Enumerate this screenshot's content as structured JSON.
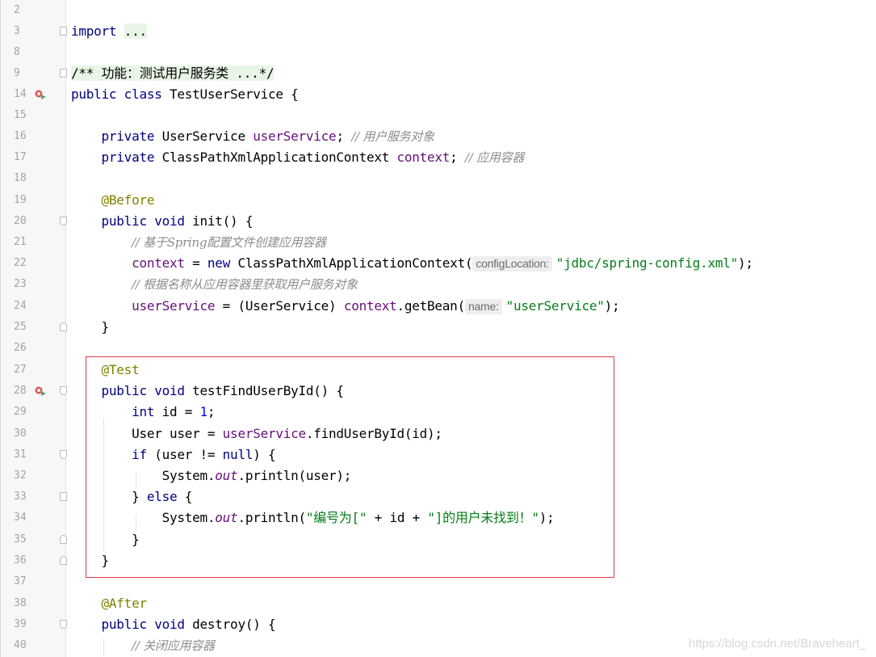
{
  "lines": [
    {
      "n": "2"
    },
    {
      "n": "3"
    },
    {
      "n": "8"
    },
    {
      "n": "9"
    },
    {
      "n": "14"
    },
    {
      "n": "15"
    },
    {
      "n": "16"
    },
    {
      "n": "17"
    },
    {
      "n": "18"
    },
    {
      "n": "19"
    },
    {
      "n": "20"
    },
    {
      "n": "21"
    },
    {
      "n": "22"
    },
    {
      "n": "23"
    },
    {
      "n": "24"
    },
    {
      "n": "25"
    },
    {
      "n": "26"
    },
    {
      "n": "27"
    },
    {
      "n": "28"
    },
    {
      "n": "29"
    },
    {
      "n": "30"
    },
    {
      "n": "31"
    },
    {
      "n": "32"
    },
    {
      "n": "33"
    },
    {
      "n": "34"
    },
    {
      "n": "35"
    },
    {
      "n": "36"
    },
    {
      "n": "37"
    },
    {
      "n": "38"
    },
    {
      "n": "39"
    },
    {
      "n": "40"
    }
  ],
  "code": {
    "import_kw": "import",
    "import_fold": "...",
    "doc_comment": "/** 功能：测试用户服务类 ...*/",
    "class_public": "public class",
    "class_name": "TestUserService {",
    "l16_private": "private",
    "l16_type": "UserService",
    "l16_field": "userService",
    "l16_semi": ";",
    "l16_comment": "// 用户服务对象",
    "l17_private": "private",
    "l17_type": "ClassPathXmlApplicationContext",
    "l17_field": "context",
    "l17_semi": ";",
    "l17_comment": "// 应用容器",
    "l19_ann": "@Before",
    "l20_kw": "public void",
    "l20_rest": "init() {",
    "l21_comment": "// 基于Spring配置文件创建应用容器",
    "l22_field": "context",
    "l22_eq": "=",
    "l22_new": "new",
    "l22_call": "ClassPathXmlApplicationContext(",
    "l22_hint": "configLocation:",
    "l22_str": "\"jdbc/spring-config.xml\"",
    "l22_end": ");",
    "l23_comment": "// 根据名称从应用容器里获取用户服务对象",
    "l24_field": "userService",
    "l24_mid": "= (UserService)",
    "l24_field2": "context",
    "l24_call": ".getBean(",
    "l24_hint": "name:",
    "l24_str": "\"userService\"",
    "l24_end": ");",
    "l25_close": "}",
    "l27_ann": "@Test",
    "l28_kw": "public void",
    "l28_rest": "testFindUserById() {",
    "l29_kw": "int",
    "l29_mid": "id =",
    "l29_num": "1",
    "l29_end": ";",
    "l30_a": "User user =",
    "l30_field": "userService",
    "l30_b": ".findUserById(id);",
    "l31_kw": "if",
    "l31_a": "(user !=",
    "l31_null": "null",
    "l31_b": ") {",
    "l32_a": "System.",
    "l32_out": "out",
    "l32_b": ".println(user);",
    "l33_a": "}",
    "l33_else": "else",
    "l33_b": "{",
    "l34_a": "System.",
    "l34_out": "out",
    "l34_b": ".println(",
    "l34_s1": "\"编号为[\"",
    "l34_c": "+ id +",
    "l34_s2": "\"]的用户未找到！\"",
    "l34_end": ");",
    "l35_close": "}",
    "l36_close": "}",
    "l38_ann": "@After",
    "l39_kw": "public void",
    "l39_rest": "destroy() {",
    "l40_comment": "// 关闭应用容器"
  },
  "watermark": "https://blog.csdn.net/Braveheart_",
  "colors": {
    "keyword": "#000080",
    "field": "#660e7a",
    "annotation": "#808000",
    "string": "#067d17",
    "number": "#0000ff",
    "comment": "#8c8c8c",
    "highlight_box": "#e0393e"
  }
}
